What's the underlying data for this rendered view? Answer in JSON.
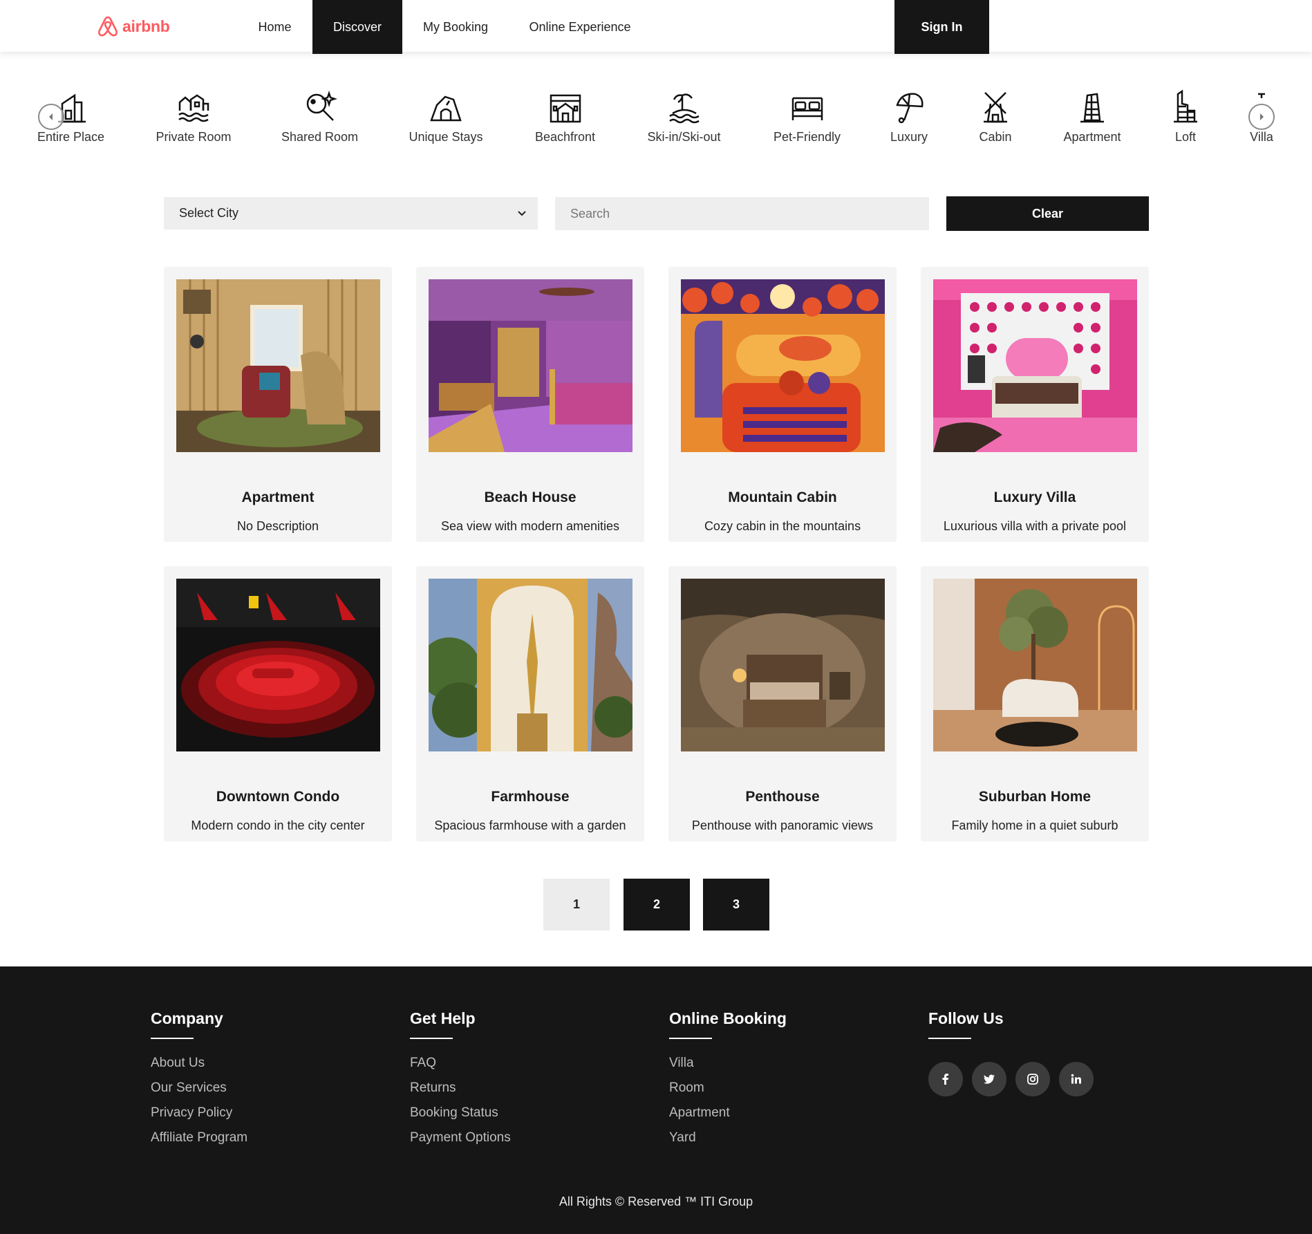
{
  "brand": {
    "name": "airbnb",
    "color": "#ff5a5f"
  },
  "nav": {
    "links": [
      "Home",
      "Discover",
      "My Booking",
      "Online Experience"
    ],
    "active": "Discover",
    "signin_label": "Sign In"
  },
  "categories": [
    {
      "label": "Entire Place",
      "icon": "house-door-icon"
    },
    {
      "label": "Private Room",
      "icon": "houses-waves-icon"
    },
    {
      "label": "Shared Room",
      "icon": "search-sparkle-icon"
    },
    {
      "label": "Unique Stays",
      "icon": "cave-icon"
    },
    {
      "label": "Beachfront",
      "icon": "building-icon"
    },
    {
      "label": "Ski-in/Ski-out",
      "icon": "island-icon"
    },
    {
      "label": "Pet-Friendly",
      "icon": "bed-icon"
    },
    {
      "label": "Luxury",
      "icon": "umbrella-icon"
    },
    {
      "label": "Cabin",
      "icon": "windmill-icon"
    },
    {
      "label": "Apartment",
      "icon": "leaning-tower-icon"
    },
    {
      "label": "Loft",
      "icon": "castle-icon"
    },
    {
      "label": "Villa",
      "icon": "villa-icon"
    }
  ],
  "filters": {
    "select_label": "Select City",
    "search_placeholder": "Search",
    "clear_label": "Clear"
  },
  "listings": [
    {
      "title": "Apartment",
      "description": "No Description",
      "image": "retro-living-room-photo"
    },
    {
      "title": "Beach House",
      "description": "Sea view with modern amenities",
      "image": "purple-bedroom-photo"
    },
    {
      "title": "Mountain Cabin",
      "description": "Cozy cabin in the mountains",
      "image": "orange-shag-bedroom-photo"
    },
    {
      "title": "Luxury Villa",
      "description": "Luxurious villa with a private pool",
      "image": "pink-bedroom-photo"
    },
    {
      "title": "Downtown Condo",
      "description": "Modern condo in the city center",
      "image": "red-racing-bed-photo"
    },
    {
      "title": "Farmhouse",
      "description": "Spacious farmhouse with a garden",
      "image": "golden-torch-alcove-photo"
    },
    {
      "title": "Penthouse",
      "description": "Penthouse with panoramic views",
      "image": "cave-bedroom-photo"
    },
    {
      "title": "Suburban Home",
      "description": "Family home in a quiet suburb",
      "image": "wood-room-olive-tree-photo"
    }
  ],
  "pagination": {
    "pages": [
      "1",
      "2",
      "3"
    ],
    "current": "1"
  },
  "footer": {
    "columns": [
      {
        "heading": "Company",
        "links": [
          "About Us",
          "Our Services",
          "Privacy Policy",
          "Affiliate Program"
        ]
      },
      {
        "heading": "Get Help",
        "links": [
          "FAQ",
          "Returns",
          "Booking Status",
          "Payment Options"
        ]
      },
      {
        "heading": "Online Booking",
        "links": [
          "Villa",
          "Room",
          "Apartment",
          "Yard"
        ]
      }
    ],
    "follow": {
      "heading": "Follow Us",
      "icons": [
        "facebook-icon",
        "twitter-icon",
        "instagram-icon",
        "linkedin-icon"
      ]
    },
    "copyright": "All Rights © Reserved ™ ITI Group"
  }
}
